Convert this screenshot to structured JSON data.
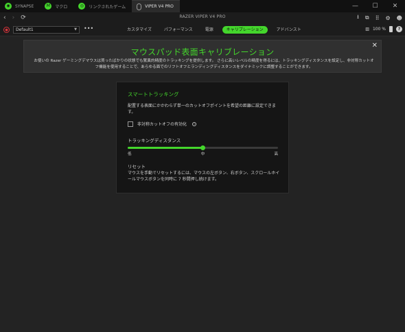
{
  "tabs": [
    {
      "label": "SYNAPSE",
      "icon": "synapse-icon",
      "active": false
    },
    {
      "label": "マクロ",
      "icon": "macro-icon",
      "active": false
    },
    {
      "label": "リンクされたゲーム",
      "icon": "linked-games-icon",
      "active": false
    },
    {
      "label": "VIPER V4 PRO",
      "icon": "mouse-icon",
      "active": true
    }
  ],
  "window_controls": {
    "minimize": "—",
    "maximize": "☐",
    "close": "✕"
  },
  "header": {
    "title": "RAZER VIPER V4 PRO",
    "back": "‹",
    "forward": "›",
    "refresh": "⟳"
  },
  "profile": {
    "value": "Default1",
    "more": "•••"
  },
  "subtabs": [
    {
      "label": "カスタマイズ",
      "active": false
    },
    {
      "label": "パフォーマンス",
      "active": false
    },
    {
      "label": "電源",
      "active": false
    },
    {
      "label": "キャリブレーション",
      "active": true
    },
    {
      "label": "アドバンスト",
      "active": false
    }
  ],
  "status": {
    "battery": "100 %",
    "help": "?"
  },
  "banner": {
    "title": "マウスパッド表面キャリブレーション",
    "description": "お使いの Razer ゲーミングデマウスは買ったばかりの状態でも驚異的精度のトラッキングを提供します。 さらに高いレベルの精度を得るには、トラッキングディスタンスを設定し、非対称カットオフ機能を使用することで、あらゆる面でのリフトオフとランディングディスタンスをダイナミックに調整することができます。",
    "close": "✕"
  },
  "smart_tracking": {
    "title": "スマートトラッキング",
    "description": "配置する表面にかかわらず単一のカットオフポイントを希望の距離に設定できます。",
    "asymmetric_label": "非対称カットオフの有効化",
    "asymmetric_checked": false,
    "distance_label": "トラッキングディスタンス",
    "distance_level": 0.5,
    "ticks": {
      "low": "低",
      "mid": "中",
      "high": "高"
    },
    "reset_title": "リセット",
    "reset_description": "マウスを手動でリセットするには、マウスの左ボタン、右ボタン、スクロールホイールマウスボタンを同時に 7 秒間押し続けます。"
  },
  "colors": {
    "accent": "#44d62c",
    "background": "#232323",
    "panel": "#151515"
  }
}
